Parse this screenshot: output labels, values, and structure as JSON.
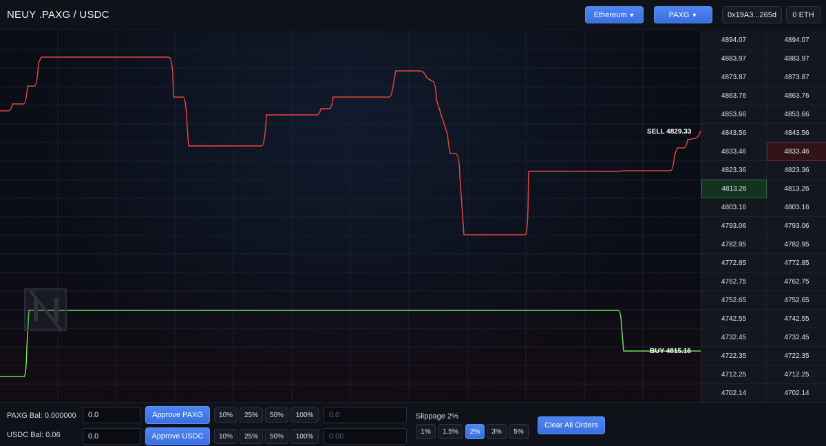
{
  "header": {
    "title": "NEUY .PAXG / USDC",
    "network_label": "Ethereum",
    "token_label": "PAXG",
    "wallet_address": "0x19A3...265d",
    "eth_balance": "0 ETH"
  },
  "chart": {
    "sell_label": "SELL",
    "sell_price": "4829.33",
    "buy_label": "BUY",
    "buy_price": "4815.16",
    "colors": {
      "sell_line": "#e8463a",
      "buy_line": "#6fe05a"
    }
  },
  "order_book": {
    "rows": [
      [
        "4894.07",
        "4894.07"
      ],
      [
        "4883.97",
        "4883.97"
      ],
      [
        "4873.87",
        "4873.87"
      ],
      [
        "4863.76",
        "4863.76"
      ],
      [
        "4853.66",
        "4853.66"
      ],
      [
        "4843.56",
        "4843.56"
      ],
      [
        "4833.46",
        "4833.46"
      ],
      [
        "4823.36",
        "4823.36"
      ],
      [
        "4813.26",
        "4813.26"
      ],
      [
        "4803.16",
        "4803.16"
      ],
      [
        "4793.06",
        "4793.06"
      ],
      [
        "4782.95",
        "4782.95"
      ],
      [
        "4772.85",
        "4772.85"
      ],
      [
        "4762.75",
        "4762.75"
      ],
      [
        "4752.65",
        "4752.65"
      ],
      [
        "4742.55",
        "4742.55"
      ],
      [
        "4732.45",
        "4732.45"
      ],
      [
        "4722.35",
        "4722.35"
      ],
      [
        "4712.25",
        "4712.25"
      ],
      [
        "4702.14",
        "4702.14"
      ]
    ],
    "highlight_buy": "4813.26",
    "highlight_sell": "4833.46"
  },
  "bottom": {
    "paxg_balance": "PAXG Bal: 0.000000",
    "usdc_balance": "USDC Bal: 0.06",
    "paxg_amount": "0.0",
    "usdc_amount": "0.0",
    "approve_paxg": "Approve PAXG",
    "approve_usdc": "Approve USDC",
    "percent_options": [
      "10%",
      "25%",
      "50%",
      "100%"
    ],
    "paxg_price_placeholder": "0.0",
    "usdc_price_placeholder": "0.00",
    "slippage_label": "Slippage 2%",
    "slippage_options": [
      "1%",
      "1.5%",
      "2%",
      "3%",
      "5%"
    ],
    "slippage_selected": "2%",
    "clear_orders": "Clear All Orders"
  }
}
